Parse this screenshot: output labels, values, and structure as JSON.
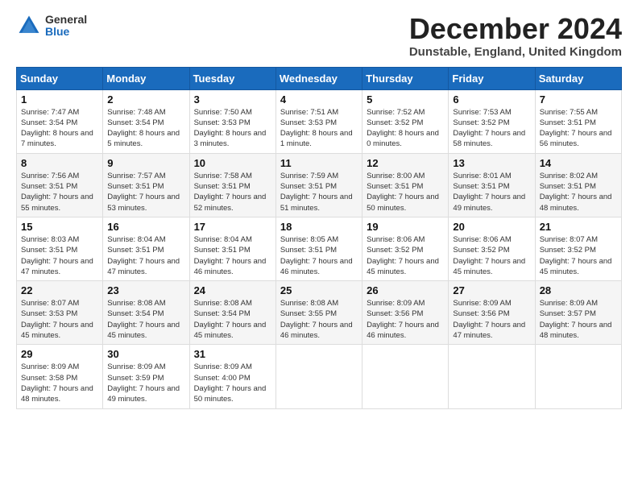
{
  "logo": {
    "general": "General",
    "blue": "Blue"
  },
  "title": "December 2024",
  "location": "Dunstable, England, United Kingdom",
  "days_header": [
    "Sunday",
    "Monday",
    "Tuesday",
    "Wednesday",
    "Thursday",
    "Friday",
    "Saturday"
  ],
  "weeks": [
    [
      {
        "day": "1",
        "sunrise": "Sunrise: 7:47 AM",
        "sunset": "Sunset: 3:54 PM",
        "daylight": "Daylight: 8 hours and 7 minutes."
      },
      {
        "day": "2",
        "sunrise": "Sunrise: 7:48 AM",
        "sunset": "Sunset: 3:54 PM",
        "daylight": "Daylight: 8 hours and 5 minutes."
      },
      {
        "day": "3",
        "sunrise": "Sunrise: 7:50 AM",
        "sunset": "Sunset: 3:53 PM",
        "daylight": "Daylight: 8 hours and 3 minutes."
      },
      {
        "day": "4",
        "sunrise": "Sunrise: 7:51 AM",
        "sunset": "Sunset: 3:53 PM",
        "daylight": "Daylight: 8 hours and 1 minute."
      },
      {
        "day": "5",
        "sunrise": "Sunrise: 7:52 AM",
        "sunset": "Sunset: 3:52 PM",
        "daylight": "Daylight: 8 hours and 0 minutes."
      },
      {
        "day": "6",
        "sunrise": "Sunrise: 7:53 AM",
        "sunset": "Sunset: 3:52 PM",
        "daylight": "Daylight: 7 hours and 58 minutes."
      },
      {
        "day": "7",
        "sunrise": "Sunrise: 7:55 AM",
        "sunset": "Sunset: 3:51 PM",
        "daylight": "Daylight: 7 hours and 56 minutes."
      }
    ],
    [
      {
        "day": "8",
        "sunrise": "Sunrise: 7:56 AM",
        "sunset": "Sunset: 3:51 PM",
        "daylight": "Daylight: 7 hours and 55 minutes."
      },
      {
        "day": "9",
        "sunrise": "Sunrise: 7:57 AM",
        "sunset": "Sunset: 3:51 PM",
        "daylight": "Daylight: 7 hours and 53 minutes."
      },
      {
        "day": "10",
        "sunrise": "Sunrise: 7:58 AM",
        "sunset": "Sunset: 3:51 PM",
        "daylight": "Daylight: 7 hours and 52 minutes."
      },
      {
        "day": "11",
        "sunrise": "Sunrise: 7:59 AM",
        "sunset": "Sunset: 3:51 PM",
        "daylight": "Daylight: 7 hours and 51 minutes."
      },
      {
        "day": "12",
        "sunrise": "Sunrise: 8:00 AM",
        "sunset": "Sunset: 3:51 PM",
        "daylight": "Daylight: 7 hours and 50 minutes."
      },
      {
        "day": "13",
        "sunrise": "Sunrise: 8:01 AM",
        "sunset": "Sunset: 3:51 PM",
        "daylight": "Daylight: 7 hours and 49 minutes."
      },
      {
        "day": "14",
        "sunrise": "Sunrise: 8:02 AM",
        "sunset": "Sunset: 3:51 PM",
        "daylight": "Daylight: 7 hours and 48 minutes."
      }
    ],
    [
      {
        "day": "15",
        "sunrise": "Sunrise: 8:03 AM",
        "sunset": "Sunset: 3:51 PM",
        "daylight": "Daylight: 7 hours and 47 minutes."
      },
      {
        "day": "16",
        "sunrise": "Sunrise: 8:04 AM",
        "sunset": "Sunset: 3:51 PM",
        "daylight": "Daylight: 7 hours and 47 minutes."
      },
      {
        "day": "17",
        "sunrise": "Sunrise: 8:04 AM",
        "sunset": "Sunset: 3:51 PM",
        "daylight": "Daylight: 7 hours and 46 minutes."
      },
      {
        "day": "18",
        "sunrise": "Sunrise: 8:05 AM",
        "sunset": "Sunset: 3:51 PM",
        "daylight": "Daylight: 7 hours and 46 minutes."
      },
      {
        "day": "19",
        "sunrise": "Sunrise: 8:06 AM",
        "sunset": "Sunset: 3:52 PM",
        "daylight": "Daylight: 7 hours and 45 minutes."
      },
      {
        "day": "20",
        "sunrise": "Sunrise: 8:06 AM",
        "sunset": "Sunset: 3:52 PM",
        "daylight": "Daylight: 7 hours and 45 minutes."
      },
      {
        "day": "21",
        "sunrise": "Sunrise: 8:07 AM",
        "sunset": "Sunset: 3:52 PM",
        "daylight": "Daylight: 7 hours and 45 minutes."
      }
    ],
    [
      {
        "day": "22",
        "sunrise": "Sunrise: 8:07 AM",
        "sunset": "Sunset: 3:53 PM",
        "daylight": "Daylight: 7 hours and 45 minutes."
      },
      {
        "day": "23",
        "sunrise": "Sunrise: 8:08 AM",
        "sunset": "Sunset: 3:54 PM",
        "daylight": "Daylight: 7 hours and 45 minutes."
      },
      {
        "day": "24",
        "sunrise": "Sunrise: 8:08 AM",
        "sunset": "Sunset: 3:54 PM",
        "daylight": "Daylight: 7 hours and 45 minutes."
      },
      {
        "day": "25",
        "sunrise": "Sunrise: 8:08 AM",
        "sunset": "Sunset: 3:55 PM",
        "daylight": "Daylight: 7 hours and 46 minutes."
      },
      {
        "day": "26",
        "sunrise": "Sunrise: 8:09 AM",
        "sunset": "Sunset: 3:56 PM",
        "daylight": "Daylight: 7 hours and 46 minutes."
      },
      {
        "day": "27",
        "sunrise": "Sunrise: 8:09 AM",
        "sunset": "Sunset: 3:56 PM",
        "daylight": "Daylight: 7 hours and 47 minutes."
      },
      {
        "day": "28",
        "sunrise": "Sunrise: 8:09 AM",
        "sunset": "Sunset: 3:57 PM",
        "daylight": "Daylight: 7 hours and 48 minutes."
      }
    ],
    [
      {
        "day": "29",
        "sunrise": "Sunrise: 8:09 AM",
        "sunset": "Sunset: 3:58 PM",
        "daylight": "Daylight: 7 hours and 48 minutes."
      },
      {
        "day": "30",
        "sunrise": "Sunrise: 8:09 AM",
        "sunset": "Sunset: 3:59 PM",
        "daylight": "Daylight: 7 hours and 49 minutes."
      },
      {
        "day": "31",
        "sunrise": "Sunrise: 8:09 AM",
        "sunset": "Sunset: 4:00 PM",
        "daylight": "Daylight: 7 hours and 50 minutes."
      },
      null,
      null,
      null,
      null
    ]
  ]
}
